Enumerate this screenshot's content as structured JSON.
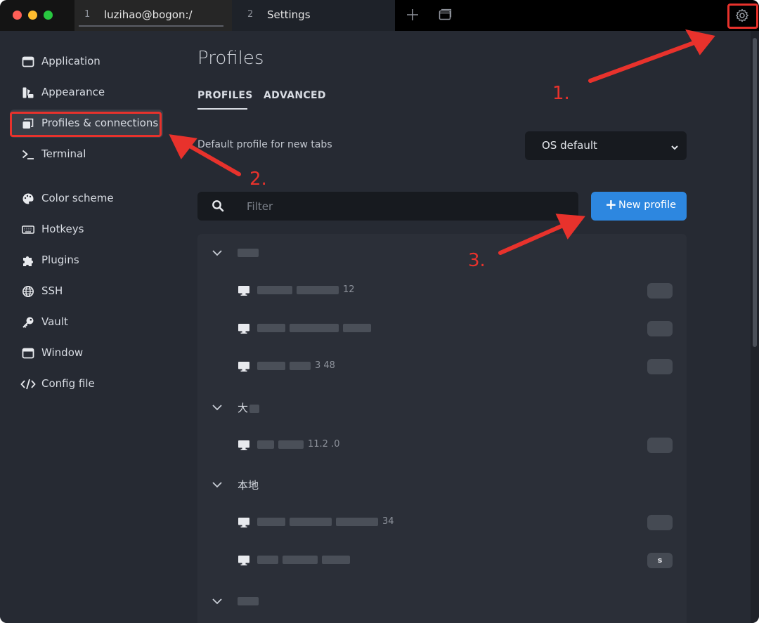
{
  "titlebar": {
    "tabs": [
      {
        "number": "1",
        "title": "luzihao@bogon:/"
      },
      {
        "number": "2",
        "title": "Settings"
      }
    ],
    "traffic_colors": {
      "close": "#ff5f57",
      "minimize": "#febc2e",
      "zoom": "#28c840"
    }
  },
  "sidebar": {
    "items": [
      {
        "label": "Application",
        "icon": "window-icon"
      },
      {
        "label": "Appearance",
        "icon": "palette-brush-icon"
      },
      {
        "label": "Profiles & connections",
        "icon": "stacked-windows-icon",
        "active": true
      },
      {
        "label": "Terminal",
        "icon": "terminal-prompt-icon"
      },
      {
        "label": "Color scheme",
        "icon": "palette-icon"
      },
      {
        "label": "Hotkeys",
        "icon": "keyboard-icon"
      },
      {
        "label": "Plugins",
        "icon": "puzzle-icon"
      },
      {
        "label": "SSH",
        "icon": "globe-icon"
      },
      {
        "label": "Vault",
        "icon": "key-icon"
      },
      {
        "label": "Window",
        "icon": "window-icon"
      },
      {
        "label": "Config file",
        "icon": "code-icon"
      }
    ]
  },
  "main": {
    "title": "Profiles",
    "tabs": [
      "PROFILES",
      "ADVANCED"
    ],
    "default_profile_label": "Default profile for new tabs",
    "default_profile_value": "OS default",
    "filter_placeholder": "Filter",
    "new_profile_label": "New profile"
  },
  "profile_groups": [
    {
      "name": "",
      "rows": [
        {
          "text": "12",
          "badge": ""
        },
        {
          "text": "",
          "badge": ""
        },
        {
          "text": "3      48",
          "badge": ""
        }
      ]
    },
    {
      "name": "大",
      "rows": [
        {
          "text": "11.2      .0",
          "badge": ""
        }
      ]
    },
    {
      "name": "本地",
      "rows": [
        {
          "text": "34",
          "badge": ""
        },
        {
          "text": "",
          "badge": "s"
        }
      ]
    },
    {
      "name": "",
      "rows": []
    }
  ],
  "annotations": {
    "step1": "1.",
    "step2": "2.",
    "step3": "3.",
    "color": "#e8322c"
  },
  "colors": {
    "accent": "#2d87e0",
    "background": "#262a33",
    "titlebar": "#141414"
  }
}
